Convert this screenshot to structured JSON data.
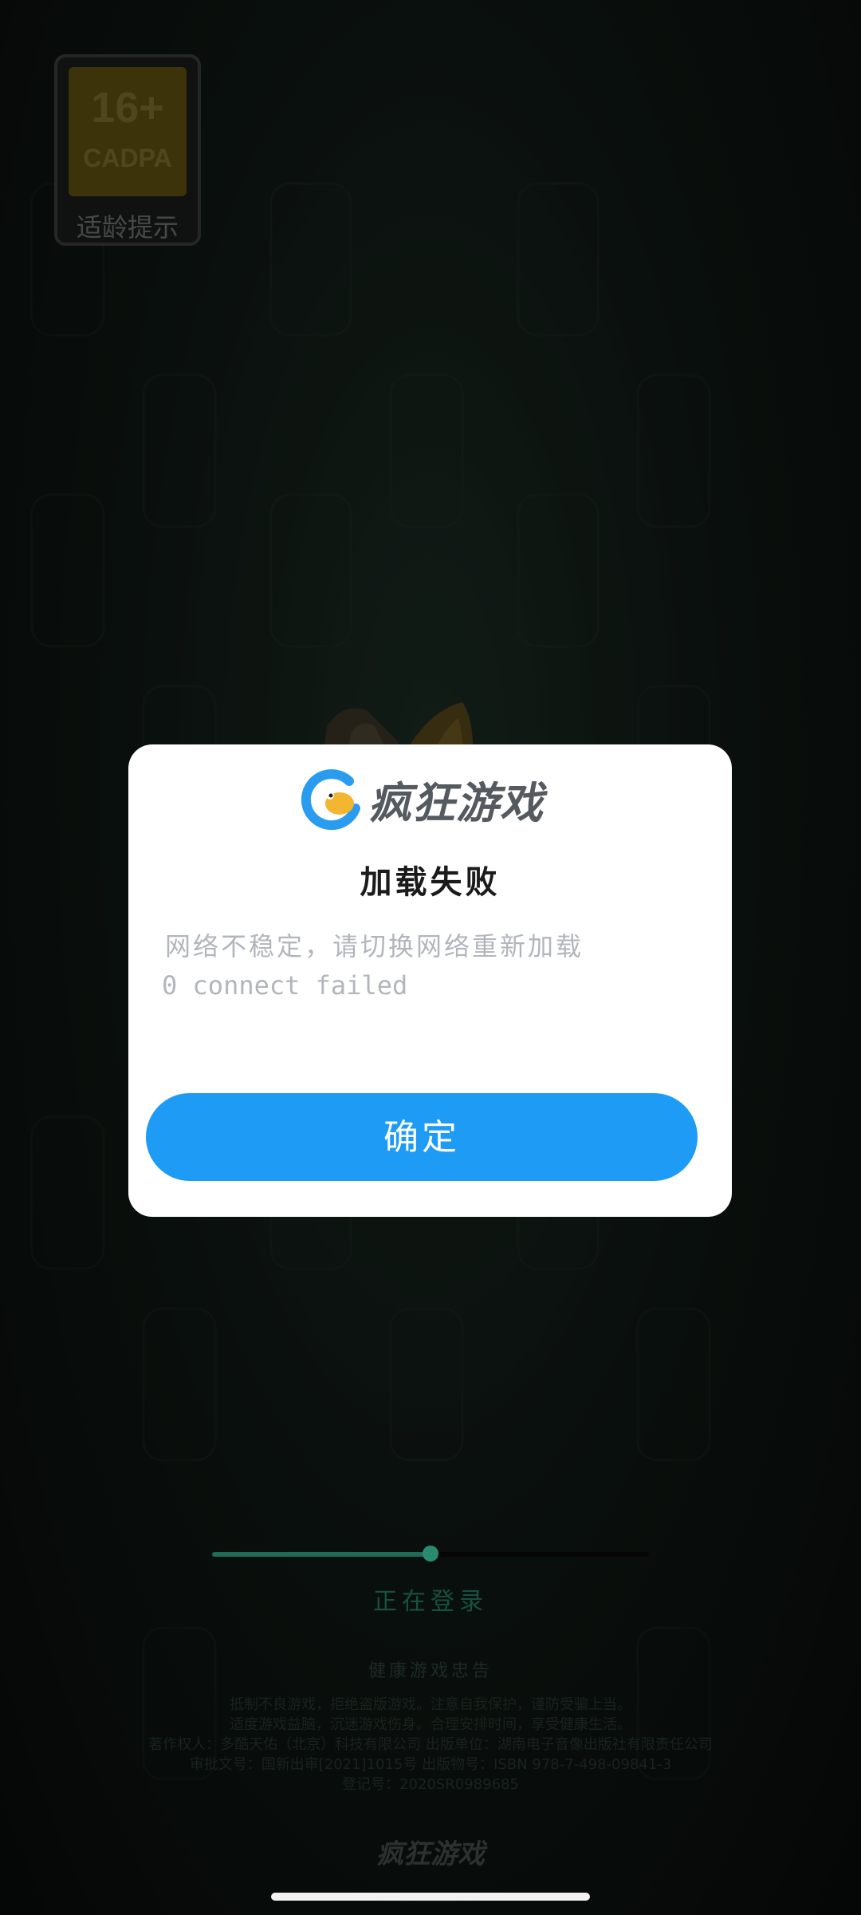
{
  "age_badge": {
    "rating": "16+",
    "org": "CADPA",
    "label": "适龄提示"
  },
  "dialog": {
    "brand": "疯狂游戏",
    "title": "加载失败",
    "message": "网络不稳定，请切换网络重新加载",
    "error": "0 connect failed",
    "confirm_label": "确定"
  },
  "loading": {
    "progress": 0.5,
    "status": "正在登录"
  },
  "health_notice": {
    "title": "健康游戏忠告",
    "lines": [
      "抵制不良游戏，拒绝盗版游戏。注意自我保护，谨防受骗上当。",
      "适度游戏益脑，沉迷游戏伤身。合理安排时间，享受健康生活。",
      "著作权人：多酷天佑（北京）科技有限公司  出版单位：湖南电子音像出版社有限责任公司",
      "审批文号：国新出审[2021]1015号  出版物号：ISBN 978-7-498-09841-3",
      "登记号：2020SR0989685"
    ]
  },
  "footer": {
    "brand": "疯狂游戏"
  },
  "colors": {
    "primary_button": "#1e9bf5",
    "logo_blue": "#2a9cf0",
    "logo_yellow": "#f4b630"
  }
}
